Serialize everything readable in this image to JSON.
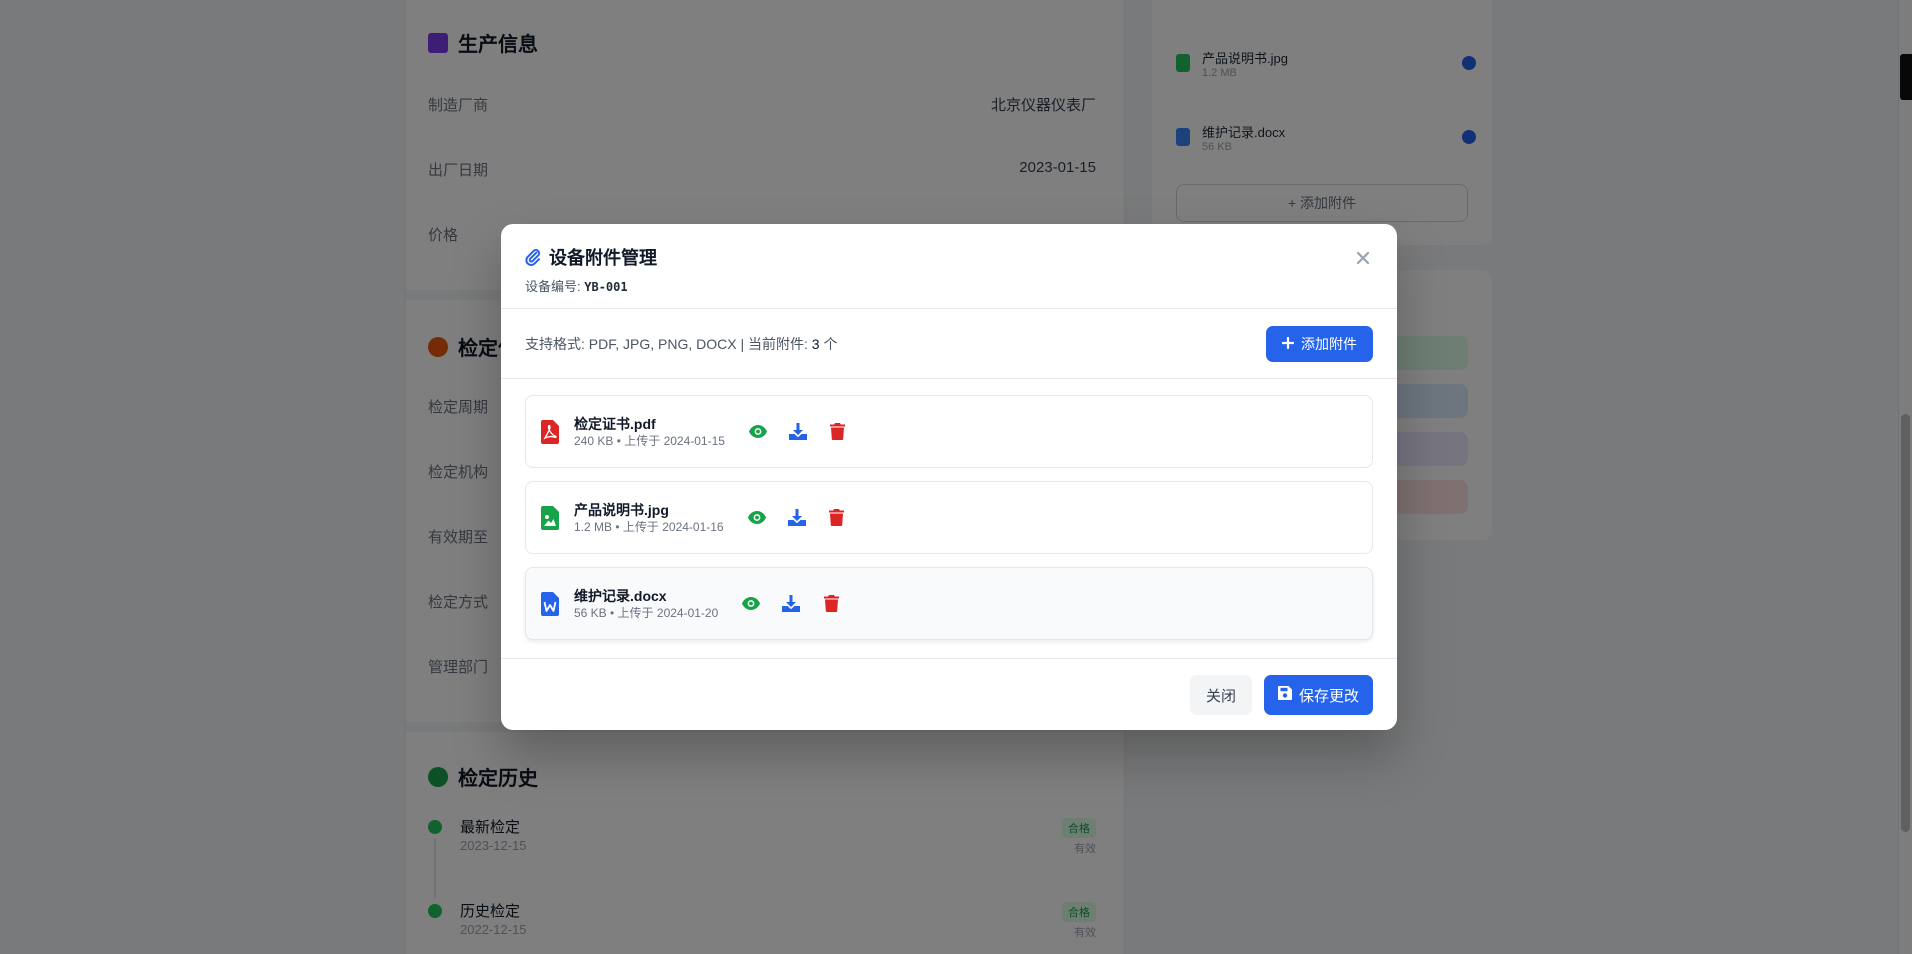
{
  "background": {
    "sections": [
      {
        "title": "生产信息",
        "color": "#7c3aed"
      },
      {
        "title": "检定信息",
        "color": "#ea580c"
      },
      {
        "title": "检定历史",
        "color": "#16a34a"
      }
    ],
    "production_rows": [
      {
        "label": "制造厂商",
        "value": "北京仪器仪表厂"
      },
      {
        "label": "出厂日期",
        "value": "2023-01-15"
      },
      {
        "label": "价格",
        "value": ""
      }
    ],
    "calibration_rows": [
      "检定周期",
      "检定机构",
      "有效期至",
      "检定方式",
      "管理部门"
    ],
    "side_files": [
      {
        "name": "产品说明书.jpg",
        "size": "1.2 MB",
        "color": "#22c55e"
      },
      {
        "name": "维护记录.docx",
        "size": "56 KB",
        "color": "#3b82f6"
      }
    ],
    "side_add_label": "+ 添加附件",
    "history": [
      {
        "name": "最新检定",
        "date": "2023-12-15",
        "badge": "合格",
        "status": "有效"
      },
      {
        "name": "历史检定",
        "date": "2022-12-15",
        "badge": "合格",
        "status": "有效"
      }
    ]
  },
  "modal": {
    "title": "设备附件管理",
    "device_label": "设备编号:",
    "device_code": "YB-001",
    "close_icon": "close-icon",
    "info_prefix": "支持格式: PDF, JPG, PNG, DOCX | 当前附件:",
    "count": "3",
    "count_suffix": "个",
    "add_label": "添加附件",
    "files": [
      {
        "name": "检定证书.pdf",
        "meta": "240 KB • 上传于 2024-01-15",
        "type": "pdf",
        "icon": "file-pdf-icon",
        "color": "#dc2626"
      },
      {
        "name": "产品说明书.jpg",
        "meta": "1.2 MB • 上传于 2024-01-16",
        "type": "image",
        "icon": "file-image-icon",
        "color": "#16a34a"
      },
      {
        "name": "维护记录.docx",
        "meta": "56 KB • 上传于 2024-01-20",
        "type": "word",
        "icon": "file-word-icon",
        "color": "#2563eb"
      }
    ],
    "close_label": "关闭",
    "save_label": "保存更改",
    "colors": {
      "primary": "#2563eb",
      "view": "#16a34a",
      "download": "#2563eb",
      "delete": "#dc2626"
    }
  }
}
